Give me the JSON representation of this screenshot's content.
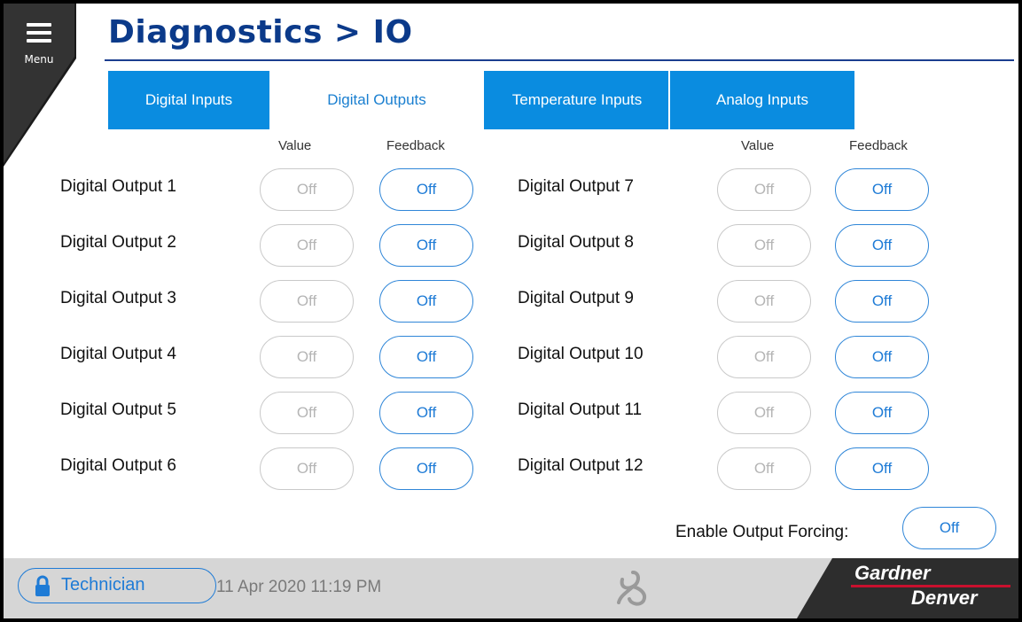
{
  "header": {
    "menu_label": "Menu",
    "title": "Diagnostics > IO"
  },
  "tabs": [
    {
      "label": "Digital Inputs",
      "active": false
    },
    {
      "label": "Digital Outputs",
      "active": true
    },
    {
      "label": "Temperature Inputs",
      "active": false
    },
    {
      "label": "Analog Inputs",
      "active": false
    }
  ],
  "columns": {
    "value": "Value",
    "feedback": "Feedback"
  },
  "outputs_left": [
    {
      "label": "Digital Output 1",
      "value": "Off",
      "feedback": "Off"
    },
    {
      "label": "Digital Output 2",
      "value": "Off",
      "feedback": "Off"
    },
    {
      "label": "Digital Output 3",
      "value": "Off",
      "feedback": "Off"
    },
    {
      "label": "Digital Output 4",
      "value": "Off",
      "feedback": "Off"
    },
    {
      "label": "Digital Output 5",
      "value": "Off",
      "feedback": "Off"
    },
    {
      "label": "Digital Output 6",
      "value": "Off",
      "feedback": "Off"
    }
  ],
  "outputs_right": [
    {
      "label": "Digital Output 7",
      "value": "Off",
      "feedback": "Off"
    },
    {
      "label": "Digital Output 8",
      "value": "Off",
      "feedback": "Off"
    },
    {
      "label": "Digital Output 9",
      "value": "Off",
      "feedback": "Off"
    },
    {
      "label": "Digital Output 10",
      "value": "Off",
      "feedback": "Off"
    },
    {
      "label": "Digital Output 11",
      "value": "Off",
      "feedback": "Off"
    },
    {
      "label": "Digital Output 12",
      "value": "Off",
      "feedback": "Off"
    }
  ],
  "forcing": {
    "label": "Enable Output Forcing:",
    "value": "Off"
  },
  "footer": {
    "user": "Technician",
    "timestamp": "11 Apr 2020  11:19 PM",
    "brand_line1": "Gardner",
    "brand_line2": "Denver"
  },
  "colors": {
    "accent": "#0a8ce0",
    "title": "#0b3a8a",
    "brand_red": "#c8102e"
  }
}
